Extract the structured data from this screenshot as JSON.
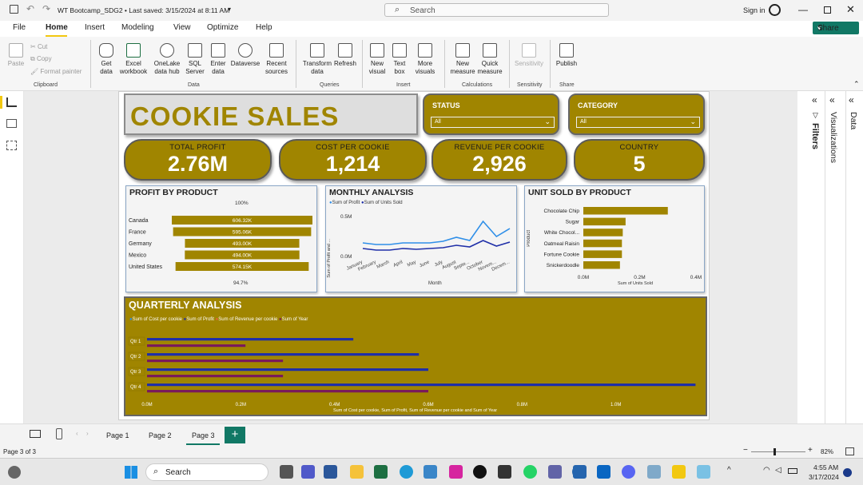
{
  "titlebar": {
    "title": "WT Bootcamp_SDG2 • Last saved: 3/15/2024 at 8:11 AM",
    "search": "Search",
    "sign_in": "Sign in"
  },
  "menu": [
    "File",
    "Home",
    "Insert",
    "Modeling",
    "View",
    "Optimize",
    "Help"
  ],
  "share": "Share",
  "ribbon": {
    "clipboard": {
      "paste": "Paste",
      "cut": "Cut",
      "copy": "Copy",
      "format_painter": "Format painter",
      "group": "Clipboard"
    },
    "data": {
      "get_data": "Get data",
      "excel": "Excel workbook",
      "onelake": "OneLake data hub",
      "sql": "SQL Server",
      "enter": "Enter data",
      "dataverse": "Dataverse",
      "recent": "Recent sources",
      "group": "Data"
    },
    "queries": {
      "transform": "Transform data",
      "refresh": "Refresh",
      "group": "Queries"
    },
    "insert": {
      "new_visual": "New visual",
      "text_box": "Text box",
      "more": "More visuals",
      "group": "Insert"
    },
    "calc": {
      "new_measure": "New measure",
      "quick_measure": "Quick measure",
      "group": "Calculations"
    },
    "sens": {
      "label": "Sensitivity",
      "group": "Sensitivity"
    },
    "share": {
      "publish": "Publish",
      "group": "Share"
    }
  },
  "right_panes": {
    "filters": "Filters",
    "visualizations": "Visualizations",
    "data": "Data"
  },
  "report": {
    "title": "COOKIE SALES",
    "status_slicer": {
      "title": "STATUS",
      "value": "All"
    },
    "category_slicer": {
      "title": "CATEGORY",
      "value": "All"
    },
    "kpis": [
      {
        "label": "TOTAL PROFIT",
        "value": "2.76M"
      },
      {
        "label": "COST PER COOKIE",
        "value": "1,214"
      },
      {
        "label": "REVENUE PER COOKIE",
        "value": "2,926"
      },
      {
        "label": "COUNTRY",
        "value": "5"
      }
    ]
  },
  "colors": {
    "gold": "#a08500",
    "blue": "#1f2fa8",
    "purple": "#7a1a5a",
    "lightblue": "#2f8fe8",
    "accent": "#f2c811"
  },
  "chart_data": [
    {
      "type": "bar",
      "title": "PROFIT BY PRODUCT",
      "top_label": "100%",
      "bottom_label": "94.7%",
      "categories": [
        "Canada",
        "France",
        "Germany",
        "Mexico",
        "United States"
      ],
      "values": [
        606.32,
        595.06,
        493.0,
        494.0,
        574.15
      ],
      "value_labels": [
        "606.32K",
        "595.06K",
        "493.00K",
        "494.00K",
        "574.15K"
      ]
    },
    {
      "type": "line",
      "title": "MONTHLY ANALYSIS",
      "xlabel": "Month",
      "ylabel": "Sum of Profit and ...",
      "yticks": [
        "0.5M",
        "0.0M"
      ],
      "ylim": [
        0,
        0.6
      ],
      "categories": [
        "January",
        "February",
        "March",
        "April",
        "May",
        "June",
        "July",
        "August",
        "Septe...",
        "October",
        "Novem...",
        "Decem..."
      ],
      "series": [
        {
          "name": "Sum of Profit",
          "values": [
            0.17,
            0.15,
            0.15,
            0.17,
            0.17,
            0.17,
            0.19,
            0.24,
            0.2,
            0.44,
            0.25,
            0.35
          ]
        },
        {
          "name": "Sum of Units Sold",
          "values": [
            0.1,
            0.08,
            0.08,
            0.1,
            0.09,
            0.1,
            0.11,
            0.14,
            0.12,
            0.2,
            0.13,
            0.18
          ]
        }
      ]
    },
    {
      "type": "bar",
      "title": "UNIT SOLD BY PRODUCT",
      "xlabel": "Sum of Units Sold",
      "ylabel": "Product",
      "xticks": [
        "0.0M",
        "0.2M",
        "0.4M"
      ],
      "xlim": [
        0,
        0.4
      ],
      "categories": [
        "Chocolate Chip",
        "Sugar",
        "White Chocol...",
        "Oatmeal Raisin",
        "Fortune Cookie",
        "Snickerdoodle"
      ],
      "values": [
        0.3,
        0.15,
        0.14,
        0.137,
        0.137,
        0.13
      ]
    },
    {
      "type": "bar",
      "title": "QUARTERLY ANALYSIS",
      "xlabel": "Sum of Cost per cookie, Sum of Profit, Sum of Revenue per cookie and Sum of Year",
      "xticks": [
        "0.0M",
        "0.2M",
        "0.4M",
        "0.6M",
        "0.8M",
        "1.0M"
      ],
      "xlim": [
        0,
        1.2
      ],
      "categories": [
        "Qtr 1",
        "Qtr 2",
        "Qtr 3",
        "Qtr 4"
      ],
      "series": [
        {
          "name": "Sum of Cost per cookie",
          "values": [
            0,
            0,
            0,
            0
          ]
        },
        {
          "name": "Sum of Profit",
          "values": [
            0.44,
            0.58,
            0.6,
            1.17
          ]
        },
        {
          "name": "Sum of Revenue per cookie",
          "values": [
            0,
            0,
            0,
            0
          ]
        },
        {
          "name": "Sum of Year",
          "values": [
            0.21,
            0.29,
            0.29,
            0.6
          ]
        }
      ]
    }
  ],
  "pages": [
    "Page 1",
    "Page 2",
    "Page 3"
  ],
  "statusbar": {
    "page": "Page 3 of 3",
    "zoom": "82%"
  },
  "taskbar": {
    "search": "Search",
    "time": "4:55 AM",
    "date": "3/17/2024"
  }
}
